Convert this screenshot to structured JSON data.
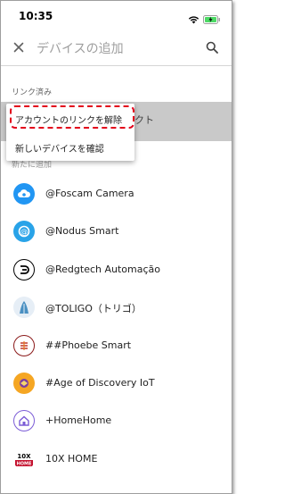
{
  "status_bar": {
    "time": "10:35"
  },
  "app_bar": {
    "search_placeholder": "デバイスの追加",
    "close_icon": "close-icon",
    "search_icon": "search-icon"
  },
  "sections": {
    "linked_header": "リンク済み",
    "linked_item_partial": "クト",
    "new_header_partial": "新たに追加"
  },
  "popup_menu": {
    "items": [
      {
        "label": "アカウントのリンクを解除",
        "highlighted": true
      },
      {
        "label": "新しいデバイスを確認",
        "highlighted": false
      }
    ],
    "highlight_color": "#e2001a"
  },
  "devices": [
    {
      "label": "@Foscam Camera",
      "icon": "foscam-cloud-icon",
      "color": "#2196f3"
    },
    {
      "label": "@Nodus Smart",
      "icon": "nodus-icon",
      "color": "#29a3e8"
    },
    {
      "label": "@Redgtech Automação",
      "icon": "redgtech-icon",
      "color": "#000000"
    },
    {
      "label": "@TOLIGO（トリゴ）",
      "icon": "toligo-icon",
      "color": "#4a90c2"
    },
    {
      "label": "##Phoebe Smart",
      "icon": "phoebe-icon",
      "color": "#8b1a1a"
    },
    {
      "label": "#Age of Discovery IoT",
      "icon": "age-of-discovery-icon",
      "color": "#f5a623"
    },
    {
      "label": "+HomeHome",
      "icon": "homehome-icon",
      "color": "#7b5cd6"
    },
    {
      "label": "10X HOME",
      "icon": "10x-home-icon",
      "color": "#c4122f",
      "logo_text": "10X HOME"
    }
  ]
}
